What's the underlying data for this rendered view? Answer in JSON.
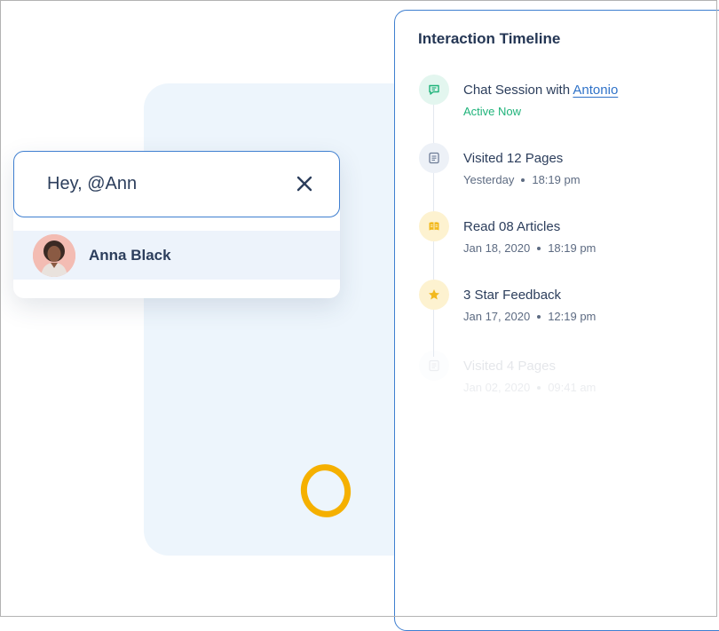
{
  "colors": {
    "accent_blue": "#3f7fd0",
    "active_green": "#1fb37a",
    "ring_yellow": "#f5b000",
    "panel_blue_bg": "#edf5fc"
  },
  "mention": {
    "input_value": "Hey, @Ann",
    "close_icon": "close-icon",
    "suggestion": {
      "name": "Anna Black",
      "avatar_icon": "avatar"
    }
  },
  "timeline": {
    "title": "Interaction Timeline",
    "items": [
      {
        "icon": "chat-icon",
        "title_prefix": "Chat Session with",
        "title_link": "Antonio",
        "status": "Active Now"
      },
      {
        "icon": "pages-icon",
        "title": "Visited 12 Pages",
        "date": "Yesterday",
        "time": "18:19 pm"
      },
      {
        "icon": "book-icon",
        "title": "Read 08 Articles",
        "date": "Jan 18, 2020",
        "time": "18:19 pm"
      },
      {
        "icon": "star-icon",
        "title": "3 Star Feedback",
        "date": "Jan 17, 2020",
        "time": "12:19 pm"
      },
      {
        "icon": "pages-icon",
        "title": "Visited 4 Pages",
        "date": "Jan 02, 2020",
        "time": "09:41 am"
      }
    ]
  }
}
